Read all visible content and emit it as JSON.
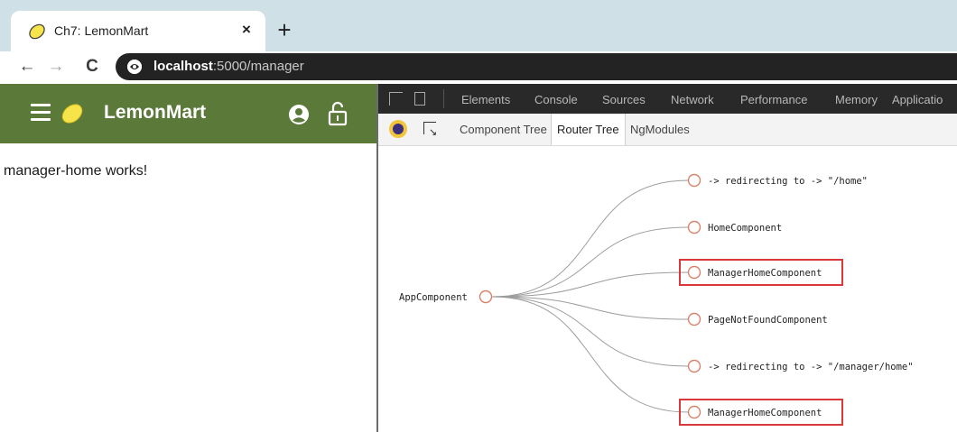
{
  "browser": {
    "tab_title": "Ch7: LemonMart",
    "close_glyph": "×",
    "new_tab_glyph": "+",
    "url_host": "localhost",
    "url_path": ":5000/manager",
    "back_glyph": "←",
    "forward_glyph": "→",
    "reload_glyph": "C"
  },
  "app": {
    "title": "LemonMart",
    "content": "manager-home works!",
    "toolbar_color": "#5b7a3a"
  },
  "devtools": {
    "tabs": [
      "Elements",
      "Console",
      "Sources",
      "Network",
      "Performance",
      "Memory",
      "Applicatio"
    ],
    "angular_tabs": [
      "Component Tree",
      "Router Tree",
      "NgModules"
    ],
    "active_angular_tab": "Router Tree"
  },
  "router_tree": {
    "root": "AppComponent",
    "children": [
      {
        "label": "-> redirecting to -> \"/home\"",
        "highlighted": false
      },
      {
        "label": "HomeComponent",
        "highlighted": false
      },
      {
        "label": "ManagerHomeComponent",
        "highlighted": true
      },
      {
        "label": "PageNotFoundComponent",
        "highlighted": false
      },
      {
        "label": "-> redirecting to -> \"/manager/home\"",
        "highlighted": false
      },
      {
        "label": "ManagerHomeComponent",
        "highlighted": true
      }
    ],
    "node_color": "#d9826a",
    "highlight_color": "#d9393a"
  }
}
